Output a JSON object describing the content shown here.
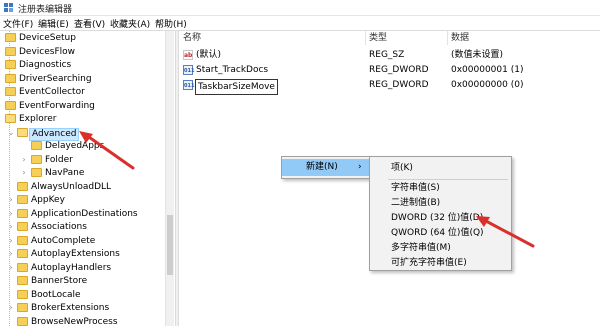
{
  "window": {
    "title": "注册表编辑器"
  },
  "menu": [
    "文件(F)",
    "编辑(E)",
    "查看(V)",
    "收藏夹(A)",
    "帮助(H)"
  ],
  "tree": [
    {
      "label": "DeviceSetup"
    },
    {
      "label": "DevicesFlow"
    },
    {
      "label": "Diagnostics"
    },
    {
      "label": "DriverSearching"
    },
    {
      "label": "EventCollector"
    },
    {
      "label": "EventForwarding"
    },
    {
      "label": "Explorer"
    },
    {
      "label": "Advanced"
    },
    {
      "label": "DelayedApps"
    },
    {
      "label": "Folder"
    },
    {
      "label": "NavPane"
    },
    {
      "label": "AlwaysUnloadDLL"
    },
    {
      "label": "AppKey"
    },
    {
      "label": "ApplicationDestinations"
    },
    {
      "label": "Associations"
    },
    {
      "label": "AutoComplete"
    },
    {
      "label": "AutoplayExtensions"
    },
    {
      "label": "AutoplayHandlers"
    },
    {
      "label": "BannerStore"
    },
    {
      "label": "BootLocale"
    },
    {
      "label": "BrokerExtensions"
    },
    {
      "label": "BrowseNewProcess"
    }
  ],
  "columns": {
    "name": "名称",
    "type": "类型",
    "data": "数据"
  },
  "values": [
    {
      "name": "(默认)",
      "type": "REG_SZ",
      "data": "(数值未设置)",
      "icon": "string-value-icon"
    },
    {
      "name": "Start_TrackDocs",
      "type": "REG_DWORD",
      "data": "0x00000001 (1)",
      "icon": "binary-value-icon"
    },
    {
      "name": "TaskbarSizeMove",
      "type": "REG_DWORD",
      "data": "0x00000000 (0)",
      "icon": "binary-value-icon"
    }
  ],
  "context_menu": {
    "new_label": "新建(N)",
    "submenu_arrow": "›"
  },
  "submenu": [
    "项(K)",
    "字符串值(S)",
    "二进制值(B)",
    "DWORD (32 位)值(D)",
    "QWORD (64 位)值(Q)",
    "多字符串值(M)",
    "可扩充字符串值(E)"
  ],
  "annotation_color": "#d9302c"
}
